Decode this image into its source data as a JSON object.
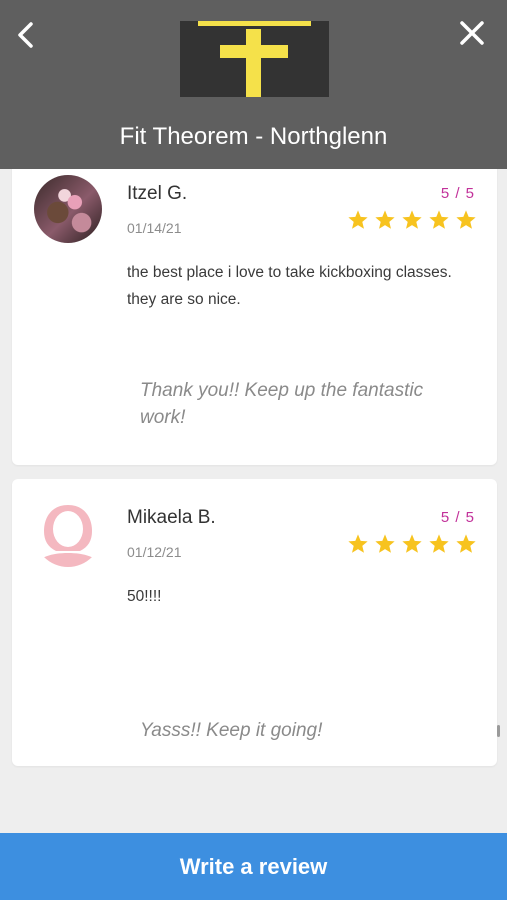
{
  "header": {
    "back_icon": "chevron-left-icon",
    "close_icon": "close-icon",
    "studio_name": "Fit Theorem - Northglenn",
    "colors": {
      "background": "#5f5f5f",
      "logo_yellow": "#f5e14a",
      "logo_background": "#333333"
    }
  },
  "reviews": [
    {
      "name": "Itzel G.",
      "date": "01/14/21",
      "rating_text": "5 / 5",
      "rating": 5,
      "text": "the best place i love to take kickboxing classes. they are so nice.",
      "reply": "Thank you!! Keep up the fantastic work!",
      "avatar": "photo"
    },
    {
      "name": "Mikaela B.",
      "date": "01/12/21",
      "rating_text": "5 / 5",
      "rating": 5,
      "text": "50!!!!",
      "reply": "Yasss!! Keep it going!",
      "avatar": "default-silhouette"
    }
  ],
  "footer": {
    "write_review_label": "Write a review"
  },
  "colors": {
    "star": "#f7c31f",
    "rating_text": "#c2319a",
    "button": "#3d8fe0"
  }
}
